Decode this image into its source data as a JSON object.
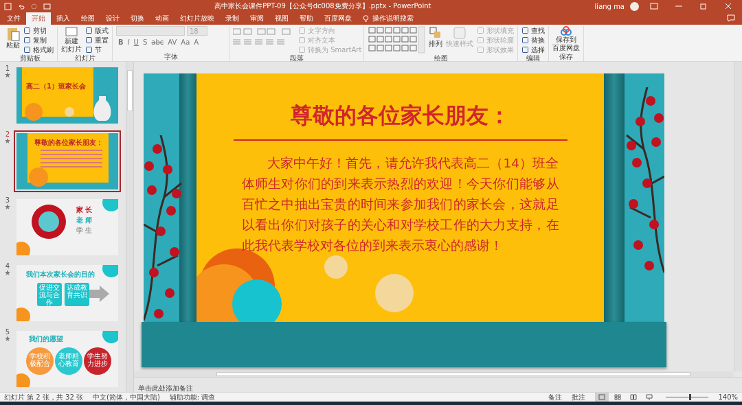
{
  "title_bar": {
    "title": "高中家长会课件PPT-09【公众号dc008免费分享】.pptx  -  PowerPoint",
    "user": "liang ma"
  },
  "tabs": [
    {
      "label": "文件",
      "selected": false
    },
    {
      "label": "开始",
      "selected": true
    },
    {
      "label": "插入",
      "selected": false
    },
    {
      "label": "绘图",
      "selected": false
    },
    {
      "label": "设计",
      "selected": false
    },
    {
      "label": "切换",
      "selected": false
    },
    {
      "label": "动画",
      "selected": false
    },
    {
      "label": "幻灯片放映",
      "selected": false
    },
    {
      "label": "录制",
      "selected": false
    },
    {
      "label": "审阅",
      "selected": false
    },
    {
      "label": "视图",
      "selected": false
    },
    {
      "label": "帮助",
      "selected": false
    },
    {
      "label": "百度网盘",
      "selected": false
    }
  ],
  "tell_me": "操作说明搜索",
  "ribbon": {
    "clipboard": {
      "label": "剪贴板",
      "paste": "粘贴",
      "items": [
        "剪切",
        "复制",
        "格式刷"
      ]
    },
    "slides": {
      "label": "幻灯片",
      "new_slide": [
        "新建",
        "幻灯片"
      ],
      "items": [
        "版式",
        "重置",
        "节"
      ]
    },
    "font": {
      "label": "字体",
      "size": "18",
      "format_buttons": [
        "B",
        "I",
        "U",
        "S",
        "abc",
        "AV",
        "Aa",
        "A"
      ]
    },
    "paragraph": {
      "label": "段落",
      "items": [
        {
          "label": "文字方向",
          "disabled": true
        },
        {
          "label": "对齐文本",
          "disabled": true
        },
        {
          "label": "转换为 SmartArt",
          "disabled": true
        }
      ]
    },
    "drawing": {
      "label": "绘图",
      "arrange": "排列",
      "quick_styles": {
        "label": "快速样式",
        "disabled": true
      },
      "items": [
        {
          "label": "形状填充",
          "disabled": true
        },
        {
          "label": "形状轮廓",
          "disabled": true
        },
        {
          "label": "形状效果",
          "disabled": true
        }
      ]
    },
    "editing": {
      "label": "编辑",
      "items": [
        "查找",
        "替换",
        "选择"
      ]
    },
    "save": {
      "label": "保存",
      "button": [
        "保存到",
        "百度网盘"
      ]
    }
  },
  "thumbnails": [
    {
      "number": "1",
      "selected": false,
      "starred": true,
      "kind": "cover",
      "texts": [
        "高二（1）班家长会"
      ]
    },
    {
      "number": "2",
      "selected": true,
      "starred": true,
      "kind": "letter",
      "texts": [
        "尊敬的各位家长朋友："
      ]
    },
    {
      "number": "3",
      "selected": false,
      "starred": true,
      "kind": "roles",
      "texts": [
        "家 长",
        "老 师",
        "学 生"
      ]
    },
    {
      "number": "4",
      "selected": false,
      "starred": true,
      "kind": "flow",
      "texts": [
        "我们本次家长会的目的",
        "促进交流与合作",
        "达成教育共识"
      ]
    },
    {
      "number": "5",
      "selected": false,
      "starred": true,
      "kind": "venn",
      "texts": [
        "我们的愿望",
        "学校积极配合",
        "老师精心教育",
        "学生努力进步"
      ]
    }
  ],
  "slide": {
    "title": "尊敬的各位家长朋友：",
    "paragraph": "大家中午好！首先，请允许我代表高二（14）班全体师生对你们的到来表示热烈的欢迎！今天你们能够从百忙之中抽出宝贵的时间来参加我们的家长会，这就足以看出你们对孩子的关心和对学校工作的大力支持，在此我代表学校对各位的到来表示衷心的感谢！"
  },
  "notes": {
    "placeholder": "单击此处添加备注"
  },
  "status_bar": {
    "items": [
      "幻灯片 第 2 张，共 32 张",
      "中文(简体，中国大陆)",
      "辅助功能: 调查"
    ],
    "notes": "备注",
    "comments": "批注",
    "views": [
      {
        "kind": "normal",
        "selected": true
      },
      {
        "kind": "sorter",
        "selected": false
      },
      {
        "kind": "reading",
        "selected": false
      },
      {
        "kind": "show",
        "selected": false
      }
    ],
    "zoom": {
      "level": 0.55,
      "reading": "140%"
    }
  }
}
